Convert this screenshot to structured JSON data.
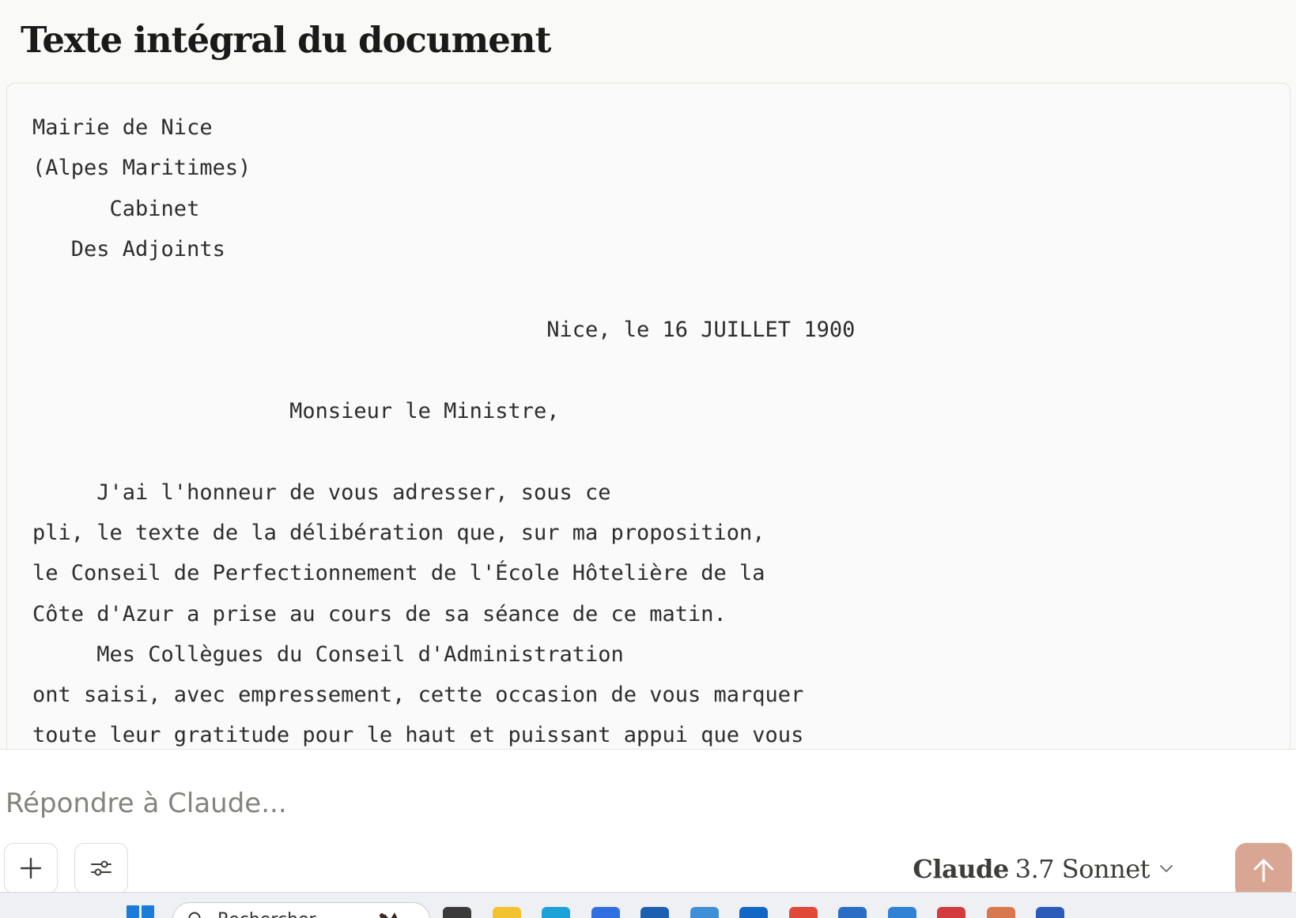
{
  "heading": "Texte intégral du document",
  "document_text": "Mairie de Nice\n(Alpes Maritimes)\n      Cabinet\n   Des Adjoints\n\n                                        Nice, le 16 JUILLET 1900\n\n                    Monsieur le Ministre,\n\n     J'ai l'honneur de vous adresser, sous ce\npli, le texte de la délibération que, sur ma proposition,\nle Conseil de Perfectionnement de l'École Hôtelière de la\nCôte d'Azur a prise au cours de sa séance de ce matin.\n     Mes Collègues du Conseil d'Administration\nont saisi, avec empressement, cette occasion de vous marquer\ntoute leur gratitude pour le haut et puissant appui que vous",
  "composer": {
    "placeholder": "Répondre à Claude...",
    "add_icon": "plus-icon",
    "settings_icon": "sliders-icon",
    "send_icon": "arrow-up-icon"
  },
  "model": {
    "name": "Claude",
    "version": "3.7 Sonnet",
    "icon": "chevron-down-icon"
  },
  "taskbar": {
    "search_text": "Rechercher",
    "apps": [
      {
        "icon": "task-view-icon",
        "color": "#3b3b3b"
      },
      {
        "icon": "file-explorer-icon",
        "color": "#f2c230"
      },
      {
        "icon": "edge-icon",
        "color": "#1da2d8"
      },
      {
        "icon": "app-blue-icon",
        "color": "#2f6fe0"
      },
      {
        "icon": "remote-desktop-icon",
        "color": "#1f5fb0"
      },
      {
        "icon": "notepad-icon",
        "color": "#3f8fd6"
      },
      {
        "icon": "outlook-icon",
        "color": "#1366c4"
      },
      {
        "icon": "chrome-icon",
        "color": "#e0483a"
      },
      {
        "icon": "store-icon",
        "color": "#2b6cc4"
      },
      {
        "icon": "visual-studio-icon",
        "color": "#2f82d6"
      },
      {
        "icon": "snipping-tool-icon",
        "color": "#d23c3c"
      },
      {
        "icon": "claude-icon",
        "color": "#d9774f"
      },
      {
        "icon": "word-icon",
        "color": "#2a5bb8"
      }
    ]
  },
  "colors": {
    "send_button": "#d9a694",
    "background": "#f9f9f7",
    "code_background": "#fafafa"
  }
}
